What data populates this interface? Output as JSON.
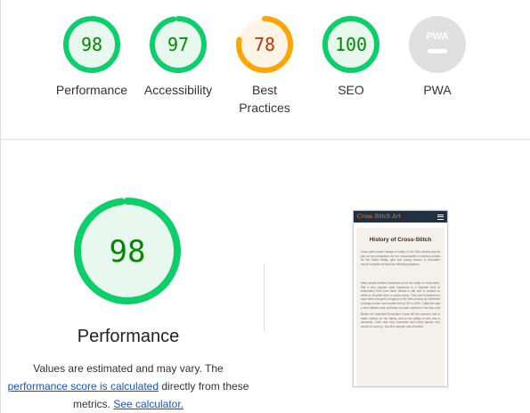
{
  "categories": [
    {
      "id": "performance",
      "score": "98",
      "label": "Performance",
      "state": "pass",
      "fraction": 0.98
    },
    {
      "id": "accessibility",
      "score": "97",
      "label": "Accessibility",
      "state": "pass",
      "fraction": 0.97
    },
    {
      "id": "best-practices",
      "score": "78",
      "label": "Best Practices",
      "label_line1": "Best",
      "label_line2": "Practices",
      "state": "average",
      "fraction": 0.78
    },
    {
      "id": "seo",
      "score": "100",
      "label": "SEO",
      "state": "pass",
      "fraction": 1.0
    },
    {
      "id": "pwa",
      "score": "",
      "label": "PWA",
      "badge": "PWA",
      "state": "na"
    }
  ],
  "colors": {
    "pass": "#0cce6b",
    "pass_fill": "#e9f8ef",
    "pass_text": "#008800",
    "average": "#ffa400",
    "average_fill": "#fff4e6",
    "average_text": "#c33300",
    "na": "#e0e0e0",
    "link": "#1155cc"
  },
  "performance": {
    "score": "98",
    "fraction": 0.98,
    "title": "Performance",
    "desc_prefix": "Values are estimated and may vary. The",
    "desc_link1": "performance score is calculated",
    "desc_mid": "directly from these",
    "desc_metrics": "metrics.",
    "desc_link2": "See calculator."
  },
  "thumbnail": {
    "brand": "Cross Stitch Art",
    "heading": "History of Cross-Stitch",
    "paragraphs": [
      "Cross stitch wasn't always a hobby. In the 18th century and as part of her preparation for the responsibility of sewing clothes for her future family, girls and young women in education would complete at least two stitching samplers.",
      "Many people believe blackwork to be the origin of cross stitch. Still a very popular craft, blackwork is a Spanish form of embroidery that uses black thread in silk and is worked on white or off-white linen or cotton fabric. This craft is believed to have been brought to England in the 16th century by Catherine of Aragon when she married Henry VIII in 1509. Catherine was a keen stitcher and continued to make clothes for the king until her death in 1536.",
      "Before the Industrial Revolution it was still the woman's role to make clothes for her family, and so the ability to sew was a necessity. Linen was very expensive and every square inch would be used up, thus the sampler was invented."
    ]
  }
}
